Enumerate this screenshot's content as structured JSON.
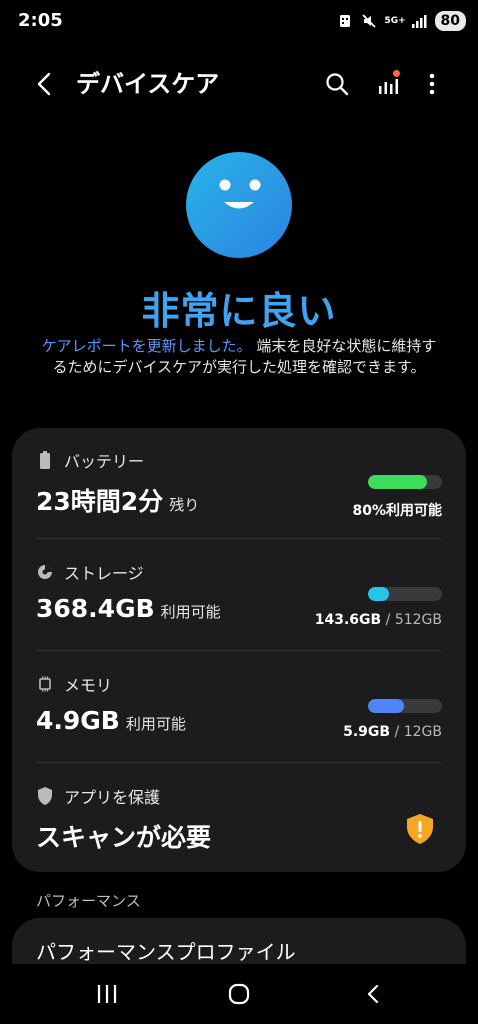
{
  "status_bar": {
    "time": "2:05",
    "network": "5G+",
    "battery": "80",
    "icons": [
      "notification-icon",
      "mute-icon",
      "signal-icon"
    ]
  },
  "app_bar": {
    "title": "デバイスケア",
    "icons": [
      "back-icon",
      "search-icon",
      "report-icon",
      "more-icon"
    ]
  },
  "hero": {
    "status": "非常に良い",
    "link_text": "ケアレポートを更新しました。",
    "description": "端末を良好な状態に維持するためにデバイスケアが実行した処理を確認できます。"
  },
  "battery": {
    "label": "バッテリー",
    "value": "23時間2分",
    "suffix": "残り",
    "right_text": "80%利用可能",
    "level_percent": 80,
    "color": "#3ddc5c"
  },
  "storage": {
    "label": "ストレージ",
    "value": "368.4GB",
    "suffix": "利用可能",
    "used": "143.6GB",
    "total": "512GB",
    "level_percent": 28,
    "color": "#24c6e8"
  },
  "memory": {
    "label": "メモリ",
    "value": "4.9GB",
    "suffix": "利用可能",
    "used": "5.9GB",
    "total": "12GB",
    "level_percent": 49,
    "color": "#4f86f7"
  },
  "protection": {
    "label": "アプリを保護",
    "value": "スキャンが必要",
    "warning_color": "#f5a623"
  },
  "performance": {
    "header": "パフォーマンス",
    "item": "パフォーマンスプロファイル"
  },
  "nav": {
    "icons": [
      "recent-apps-icon",
      "home-icon",
      "back-nav-icon"
    ]
  }
}
